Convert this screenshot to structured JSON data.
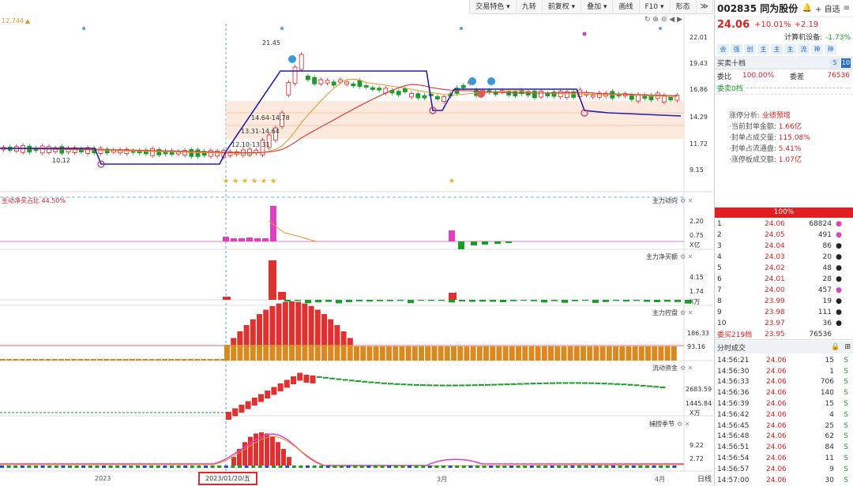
{
  "toolbar": {
    "items": [
      "交易特色 ▾",
      "九转",
      "前复权 ▾",
      "叠加 ▾",
      "画线",
      "F10 ▾",
      "形态",
      "≫"
    ]
  },
  "main_chart": {
    "price_marker": "12.744",
    "y_ticks": [
      "22.01",
      "19.43",
      "16.86",
      "14.29",
      "11.72",
      "9.15"
    ],
    "high_label": "21.45",
    "low_label": "10.12",
    "zone_labels": [
      "14.64-14.78",
      "13.31-14.64",
      "12.10-13.31"
    ]
  },
  "panels": {
    "p1": {
      "left_title": "主动净买占比 44.50%",
      "right_title": "主力动向",
      "y_ticks": [
        "2.20",
        "0.75"
      ],
      "unit": "X亿"
    },
    "p2": {
      "right_title": "主力净买额",
      "y_ticks": [
        "4.15",
        "1.74"
      ],
      "unit": "X万"
    },
    "p3": {
      "right_title": "主力控盘",
      "y_ticks": [
        "186.33",
        "93.16"
      ]
    },
    "p4": {
      "right_title": "流动资金",
      "y_ticks": [
        "2683.59",
        "1445.84"
      ],
      "unit": "X万"
    },
    "p5": {
      "right_title": "捕捞季节",
      "y_ticks": [
        "9.22",
        "2.72"
      ]
    }
  },
  "x_axis": {
    "labels": [
      "2023",
      "3月",
      "4月"
    ],
    "selected_date": "2023/01/20/五",
    "period_button": "日线"
  },
  "side": {
    "code_name": "002835 同为股份",
    "add_label": "+ 自选",
    "price": "24.06",
    "change_pct": "+10.01%",
    "change_abs": "+2.19",
    "industry": "计算机设备:",
    "industry_chg": "-1.73%",
    "tags": [
      "会",
      "强",
      "创",
      "主",
      "主",
      "主",
      "流",
      "神",
      "神"
    ],
    "section_title": "买卖十档",
    "weibi_label": "委比",
    "weibi_value": "100.00%",
    "weicha_label": "委差",
    "weicha_value": "76536",
    "sell_label": "委卖0档",
    "analysis": [
      {
        "k": "涨停分析:",
        "v": "业绩预增"
      },
      {
        "k": "·当前封单金额:",
        "v": "1.66亿"
      },
      {
        "k": "·封单占成交量:",
        "v": "115.08%"
      },
      {
        "k": "·封单占流通盘:",
        "v": "5.41%"
      },
      {
        "k": "·涨停板成交额:",
        "v": "1.07亿"
      }
    ],
    "pct_bar": "100%",
    "bids": [
      {
        "n": "1",
        "p": "24.06",
        "v": "68824",
        "dot": "pink"
      },
      {
        "n": "2",
        "p": "24.05",
        "v": "491",
        "dot": "pink"
      },
      {
        "n": "3",
        "p": "24.04",
        "v": "86",
        "dot": "black"
      },
      {
        "n": "4",
        "p": "24.03",
        "v": "20",
        "dot": "black"
      },
      {
        "n": "5",
        "p": "24.02",
        "v": "48",
        "dot": "black"
      },
      {
        "n": "6",
        "p": "24.01",
        "v": "28",
        "dot": "black"
      },
      {
        "n": "7",
        "p": "24.00",
        "v": "457",
        "dot": "pink"
      },
      {
        "n": "8",
        "p": "23.99",
        "v": "19",
        "dot": "black"
      },
      {
        "n": "9",
        "p": "23.98",
        "v": "111",
        "dot": "black"
      },
      {
        "n": "10",
        "p": "23.97",
        "v": "36",
        "dot": "black"
      }
    ],
    "buy_summary": {
      "label": "委买219档",
      "price": "23.95",
      "vol": "76536"
    },
    "ticks_title": "分时成交",
    "ticks": [
      {
        "t": "14:56:21",
        "p": "24.06",
        "v": "15",
        "s": "S"
      },
      {
        "t": "14:56:30",
        "p": "24.06",
        "v": "1",
        "s": "S"
      },
      {
        "t": "14:56:33",
        "p": "24.06",
        "v": "706",
        "s": "S"
      },
      {
        "t": "14:56:36",
        "p": "24.06",
        "v": "140",
        "s": "S"
      },
      {
        "t": "14:56:39",
        "p": "24.06",
        "v": "15",
        "s": "S"
      },
      {
        "t": "14:56:42",
        "p": "24.06",
        "v": "4",
        "s": "S"
      },
      {
        "t": "14:56:45",
        "p": "24.06",
        "v": "25",
        "s": "S"
      },
      {
        "t": "14:56:48",
        "p": "24.06",
        "v": "62",
        "s": "S"
      },
      {
        "t": "14:56:51",
        "p": "24.06",
        "v": "84",
        "s": "S"
      },
      {
        "t": "14:56:54",
        "p": "24.06",
        "v": "11",
        "s": "S"
      },
      {
        "t": "14:56:57",
        "p": "24.06",
        "v": "9",
        "s": "S"
      },
      {
        "t": "14:57:00",
        "p": "24.06",
        "v": "30",
        "s": "S"
      }
    ]
  },
  "colors": {
    "up": "#e02020",
    "down": "#1a9c2a",
    "blue_line": "#1f1fb0",
    "orange": "#e8912a",
    "pink": "#e040c0"
  }
}
